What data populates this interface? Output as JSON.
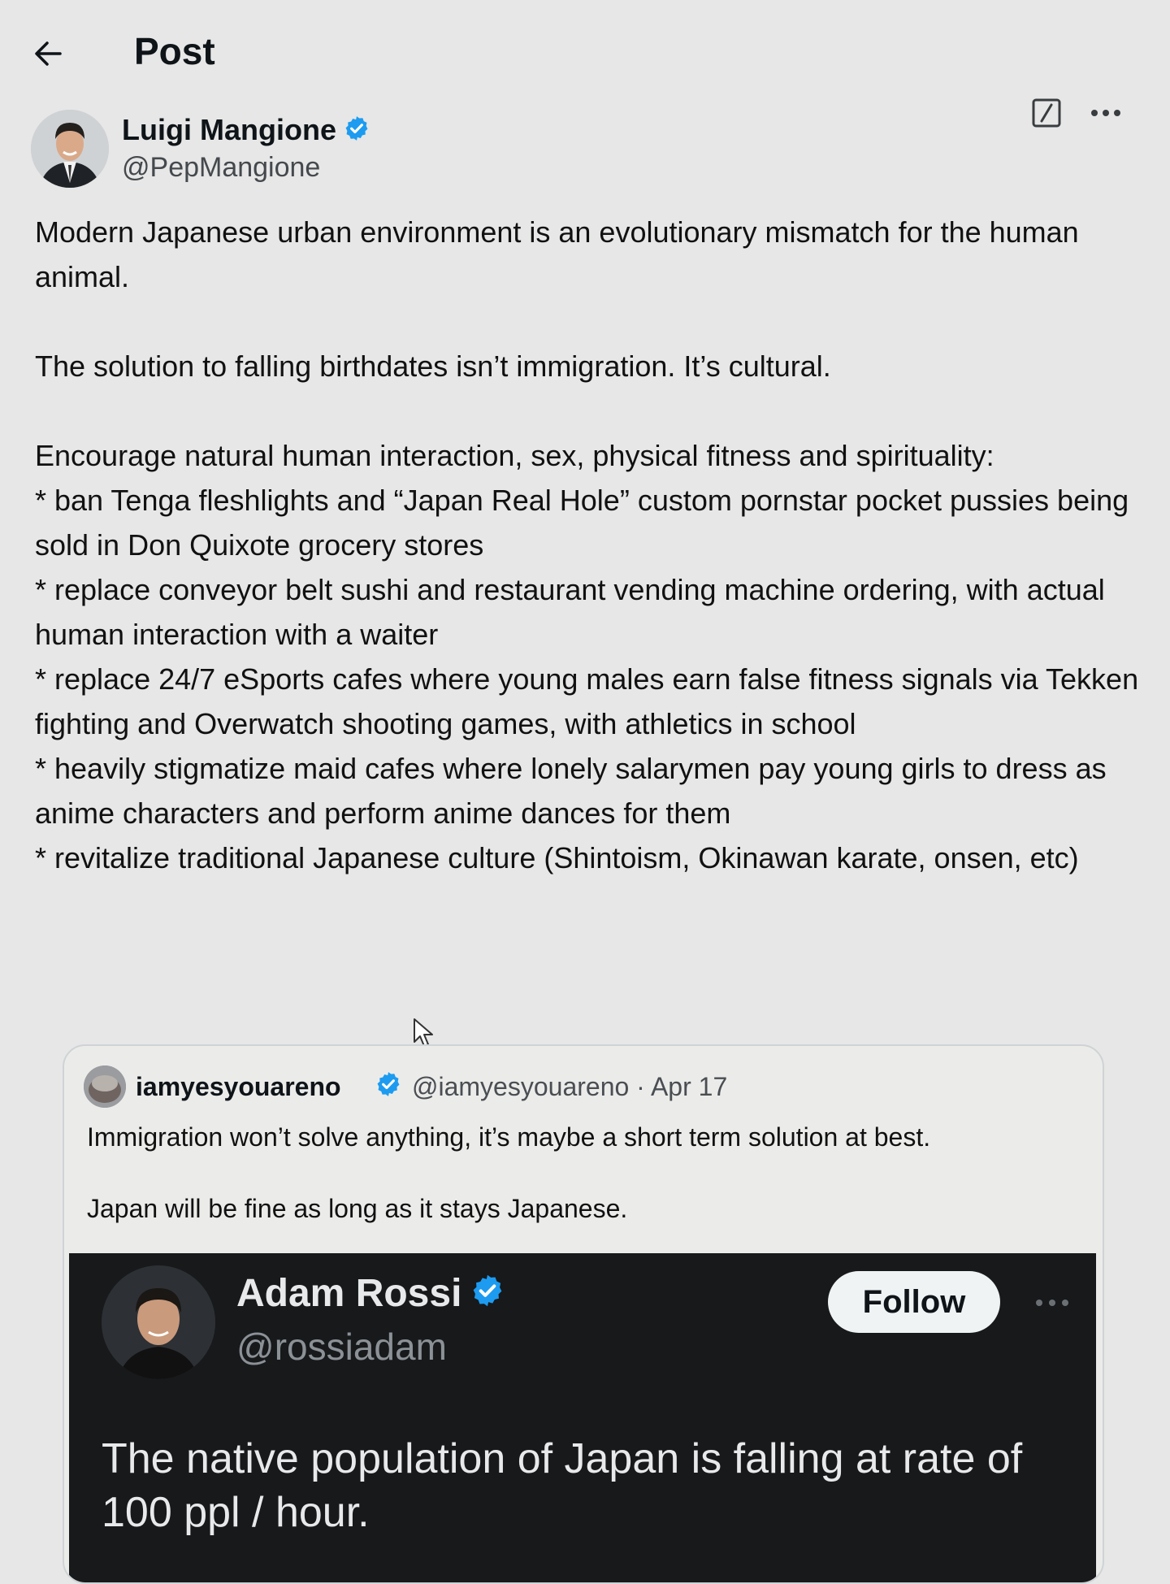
{
  "header": {
    "title": "Post"
  },
  "post": {
    "author": {
      "name": "Luigi Mangione",
      "handle": "@PepMangione"
    },
    "paragraphs": [
      "Modern Japanese urban environment is an evolutionary mismatch for the human animal.",
      "The solution to falling birthdates isn’t immigration. It’s cultural.",
      "Encourage natural human interaction, sex, physical fitness and spirituality:"
    ],
    "bullets": [
      "* ban Tenga fleshlights and “Japan Real Hole” custom pornstar pocket pussies being sold in Don Quixote grocery stores",
      "* replace conveyor belt sushi and restaurant vending machine ordering, with actual human interaction with a waiter",
      "* replace 24/7 eSports cafes where young males earn false fitness signals via Tekken fighting and Overwatch shooting games, with athletics in school",
      "* heavily stigmatize maid cafes where lonely salarymen pay young girls to dress as anime characters and perform anime dances for them",
      "* revitalize traditional Japanese culture (Shintoism, Okinawan karate, onsen, etc)"
    ]
  },
  "quote": {
    "name": "iamyesyouareno",
    "handle_date": "@iamyesyouareno · Apr 17",
    "lines": [
      "Immigration won’t solve anything, it’s maybe a short term solution at best.",
      "Japan will be fine as long as it stays Japanese."
    ],
    "media": {
      "name": "Adam Rossi",
      "handle": "@rossiadam",
      "follow_label": "Follow",
      "text": "The native population of Japan is falling at rate of 100 ppl / hour."
    }
  },
  "colors": {
    "verified": "#1d9bf0",
    "media_bg": "#17191b",
    "page_bg": "#e6e7e6"
  },
  "icons": {
    "back": "arrow-left-icon",
    "grok": "grok-icon",
    "more": "more-horizontal-icon",
    "verified": "verified-badge-icon",
    "cursor": "mouse-pointer-icon"
  }
}
